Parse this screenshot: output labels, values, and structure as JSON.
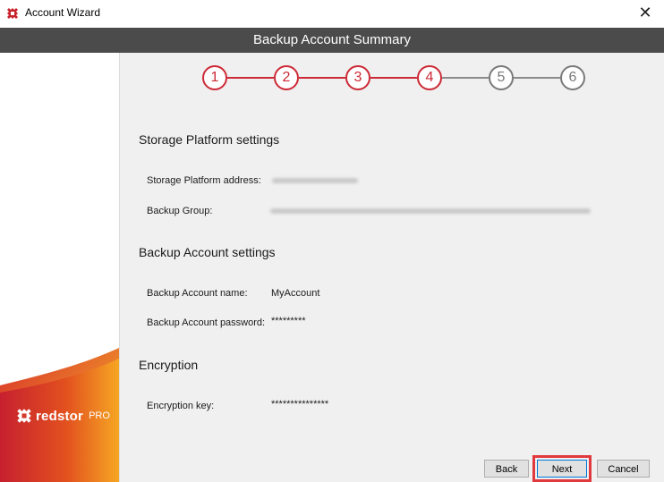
{
  "window": {
    "title": "Account Wizard",
    "close_glyph": "✕"
  },
  "banner": {
    "title": "Backup Account Summary"
  },
  "steps": [
    {
      "label": "1",
      "state": "complete"
    },
    {
      "label": "2",
      "state": "complete"
    },
    {
      "label": "3",
      "state": "complete"
    },
    {
      "label": "4",
      "state": "current"
    },
    {
      "label": "5",
      "state": "pending"
    },
    {
      "label": "6",
      "state": "pending"
    }
  ],
  "colors": {
    "accent_red": "#cc2a36",
    "banner_gray": "#4b4b4b",
    "pending_gray": "#7a7a7a",
    "highlight_red": "#e0393e"
  },
  "storage": {
    "heading": "Storage Platform settings",
    "address_label": "Storage Platform address:",
    "group_label": "Backup Group:"
  },
  "account": {
    "heading": "Backup Account settings",
    "name_label": "Backup Account name:",
    "name_value": "MyAccount",
    "password_label": "Backup Account password:",
    "password_value": "*********"
  },
  "encryption": {
    "heading": "Encryption",
    "key_label": "Encryption key:",
    "key_value": "***************"
  },
  "sidebar": {
    "brand_name": "redstor",
    "brand_suffix": "PRO"
  },
  "buttons": {
    "back": "Back",
    "next": "Next",
    "cancel": "Cancel"
  }
}
